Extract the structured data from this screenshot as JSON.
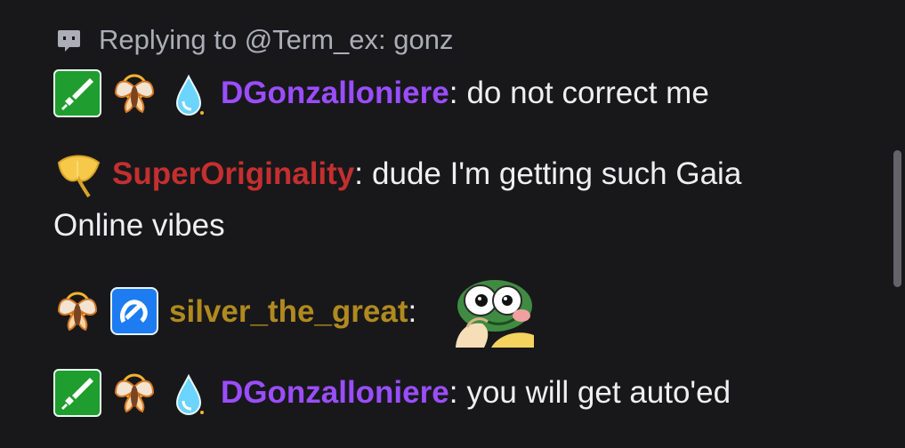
{
  "reply": {
    "icon": "reply-chat-icon",
    "text": "Replying to @Term_ex: gonz"
  },
  "messages": [
    {
      "badges": [
        "green-sword-badge",
        "moth-badge",
        "water-drop-badge"
      ],
      "username": "DGonzalloniere",
      "username_color": "#9a4dff",
      "colon": ":",
      "text": "do not correct me"
    },
    {
      "badges": [
        "ginkgo-leaf-badge"
      ],
      "username": "SuperOriginality",
      "username_color": "#c42f2f",
      "colon": ":",
      "text_line_1": "dude I'm getting such Gaia",
      "text_line_2": "Online vibes"
    },
    {
      "badges": [
        "moth-badge",
        "blue-logo-badge"
      ],
      "username": "silver_the_great",
      "username_color": "#b08a1f",
      "colon": ":",
      "emote": "pepe-thinking-emote"
    },
    {
      "badges": [
        "green-sword-badge",
        "moth-badge",
        "water-drop-badge"
      ],
      "username": "DGonzalloniere",
      "username_color": "#9a4dff",
      "colon": ":",
      "text": "you will get auto'ed"
    }
  ],
  "colors": {
    "background": "#18181b",
    "text": "#efeff1",
    "muted": "#adadb8",
    "scrollbar": "#636369"
  }
}
